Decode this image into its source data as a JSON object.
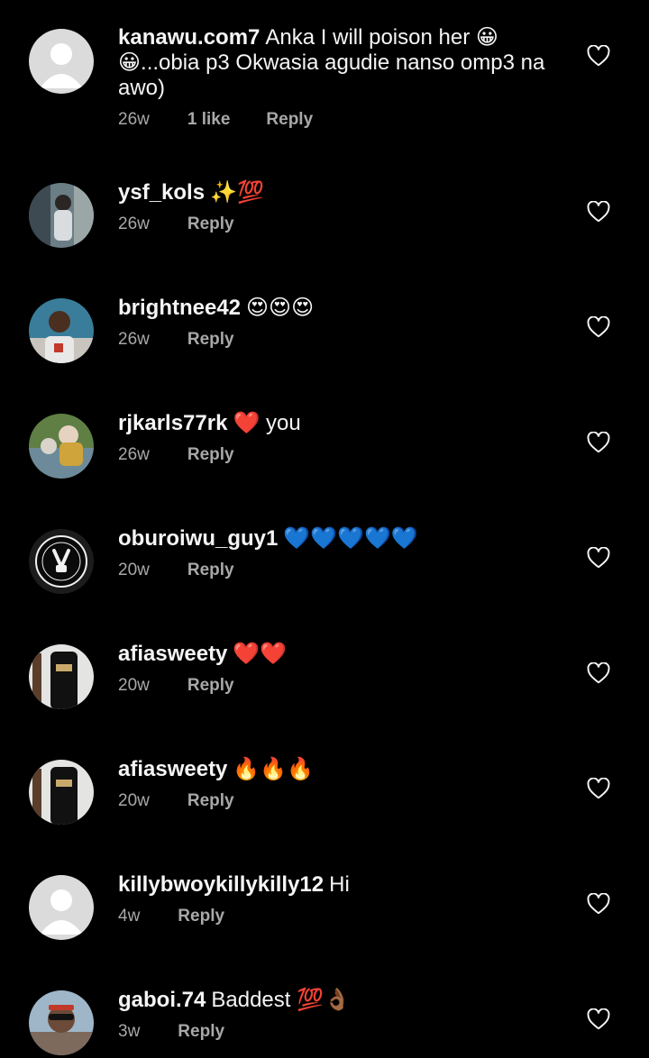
{
  "comments": [
    {
      "username": "kanawu.com7",
      "text": "Anka I will poison her 😀 😀...obia p3 Okwasia agudie nanso omp3 na awo)",
      "time": "26w",
      "likes": "1 like",
      "reply": "Reply",
      "avatar": "default"
    },
    {
      "username": "ysf_kols",
      "text": "✨💯",
      "time": "26w",
      "reply": "Reply",
      "avatar": "photo"
    },
    {
      "username": "brightnee42",
      "text": "😍😍😍",
      "time": "26w",
      "reply": "Reply",
      "avatar": "photo"
    },
    {
      "username": "rjkarls77rk",
      "text": "❤️ you",
      "time": "26w",
      "reply": "Reply",
      "avatar": "photo"
    },
    {
      "username": "oburoiwu_guy1",
      "text": "💙💙💙💙💙",
      "time": "20w",
      "reply": "Reply",
      "avatar": "logo"
    },
    {
      "username": "afiasweety",
      "text": "❤️❤️",
      "time": "20w",
      "reply": "Reply",
      "avatar": "photo"
    },
    {
      "username": "afiasweety",
      "text": "🔥🔥🔥",
      "time": "20w",
      "reply": "Reply",
      "avatar": "photo"
    },
    {
      "username": "killybwoykillykilly12",
      "text": "Hi",
      "time": "4w",
      "reply": "Reply",
      "avatar": "default"
    },
    {
      "username": "gaboi.74",
      "text": "Baddest 💯👌🏾",
      "time": "3w",
      "reply": "Reply",
      "avatar": "photo"
    }
  ],
  "icons": {
    "like": "heart-outline-icon",
    "default_avatar": "default-avatar-icon"
  },
  "colors": {
    "background": "#000000",
    "text": "#f5f5f5",
    "muted": "#a8a8a8"
  }
}
